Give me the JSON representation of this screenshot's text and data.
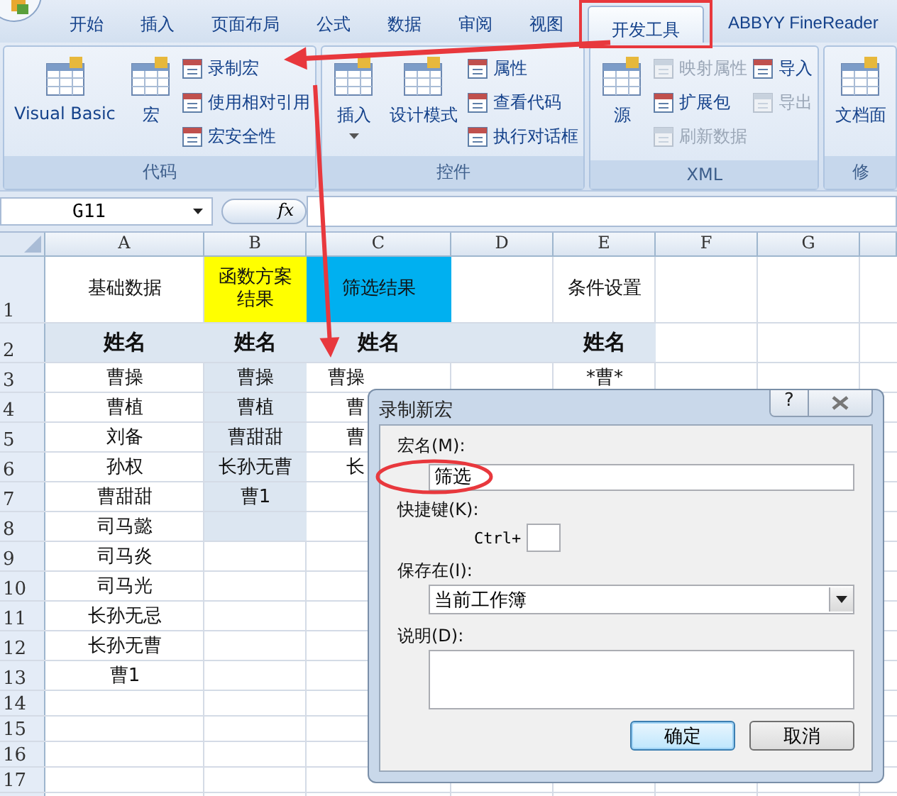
{
  "tabs": [
    {
      "label": "开始",
      "selected": false
    },
    {
      "label": "插入",
      "selected": false
    },
    {
      "label": "页面布局",
      "selected": false
    },
    {
      "label": "公式",
      "selected": false
    },
    {
      "label": "数据",
      "selected": false
    },
    {
      "label": "审阅",
      "selected": false
    },
    {
      "label": "视图",
      "selected": false
    },
    {
      "label": "开发工具",
      "selected": true
    },
    {
      "label": "ABBYY FineReader",
      "selected": false
    }
  ],
  "ribbon": {
    "groups": [
      {
        "label": "代码",
        "items": [
          {
            "label": "Visual Basic",
            "kind": "large",
            "disabled": false,
            "dropdown": false
          },
          {
            "label": "宏",
            "kind": "large",
            "disabled": false,
            "dropdown": false
          },
          {
            "label": "录制宏",
            "kind": "small",
            "disabled": false,
            "dropdown": false
          },
          {
            "label": "使用相对引用",
            "kind": "small",
            "disabled": false,
            "dropdown": false
          },
          {
            "label": "宏安全性",
            "kind": "small",
            "disabled": false,
            "dropdown": false
          }
        ]
      },
      {
        "label": "控件",
        "items": [
          {
            "label": "插入",
            "kind": "large",
            "disabled": false,
            "dropdown": true
          },
          {
            "label": "设计模式",
            "kind": "large",
            "disabled": false,
            "dropdown": false
          },
          {
            "label": "属性",
            "kind": "small",
            "disabled": false,
            "dropdown": false
          },
          {
            "label": "查看代码",
            "kind": "small",
            "disabled": false,
            "dropdown": false
          },
          {
            "label": "执行对话框",
            "kind": "small",
            "disabled": false,
            "dropdown": false
          }
        ]
      },
      {
        "label": "XML",
        "items": [
          {
            "label": "源",
            "kind": "large",
            "disabled": false,
            "dropdown": false
          },
          {
            "label": "映射属性",
            "kind": "small",
            "disabled": true,
            "dropdown": false
          },
          {
            "label": "扩展包",
            "kind": "small",
            "disabled": false,
            "dropdown": false
          },
          {
            "label": "刷新数据",
            "kind": "small",
            "disabled": true,
            "dropdown": false
          },
          {
            "label": "导入",
            "kind": "small",
            "disabled": false,
            "dropdown": false
          },
          {
            "label": "导出",
            "kind": "small",
            "disabled": true,
            "dropdown": false
          }
        ]
      },
      {
        "label": "修",
        "items": [
          {
            "label": "文档面",
            "kind": "large",
            "disabled": false,
            "dropdown": false
          }
        ]
      }
    ]
  },
  "formula_bar": {
    "name_box": "G11",
    "function_label": "fx"
  },
  "sheet": {
    "columns": [
      "A",
      "B",
      "C",
      "D",
      "E",
      "F",
      "G"
    ],
    "rows": [
      {
        "number": "1",
        "kind": "title",
        "cells": [
          {
            "text": "基础数据"
          },
          {
            "text": "函数方案结果",
            "color": "#ffff00"
          },
          {
            "text": "筛选结果",
            "color": "#00b0f0"
          },
          null,
          {
            "text": "条件设置"
          }
        ]
      },
      {
        "number": "2",
        "kind": "header",
        "cells": [
          {
            "text": "姓名",
            "color": "#dce6f1"
          },
          {
            "text": "姓名",
            "color": "#dce6f1"
          },
          {
            "text": "姓名",
            "color": "#dce6f1"
          },
          {
            "color": "#dce6f1"
          },
          {
            "text": "姓名",
            "color": "#dce6f1"
          }
        ]
      },
      {
        "number": "3",
        "kind": "data",
        "cells": [
          {
            "text": "曹操"
          },
          {
            "text": "曹操",
            "color": "#dce6f1"
          },
          {
            "text": "曹操"
          },
          null,
          {
            "text": "*曹*"
          }
        ]
      },
      {
        "number": "4",
        "kind": "data",
        "cells": [
          {
            "text": "曹植"
          },
          {
            "text": "曹植",
            "color": "#dce6f1"
          },
          {
            "text": "曹"
          }
        ]
      },
      {
        "number": "5",
        "kind": "data",
        "cells": [
          {
            "text": "刘备"
          },
          {
            "text": "曹甜甜",
            "color": "#dce6f1"
          },
          {
            "text": "曹"
          }
        ]
      },
      {
        "number": "6",
        "kind": "data",
        "cells": [
          {
            "text": "孙权"
          },
          {
            "text": "长孙无曹",
            "color": "#dce6f1"
          },
          {
            "text": "长"
          }
        ]
      },
      {
        "number": "7",
        "kind": "data",
        "cells": [
          {
            "text": "曹甜甜"
          },
          {
            "text": "曹1",
            "color": "#dce6f1"
          }
        ]
      },
      {
        "number": "8",
        "kind": "data",
        "cells": [
          {
            "text": "司马懿"
          },
          {
            "color": "#dce6f1"
          }
        ]
      },
      {
        "number": "9",
        "kind": "data",
        "cells": [
          {
            "text": "司马炎"
          }
        ]
      },
      {
        "number": "10",
        "kind": "data",
        "cells": [
          {
            "text": "司马光"
          }
        ]
      },
      {
        "number": "11",
        "kind": "data",
        "cells": [
          {
            "text": "长孙无忌"
          }
        ]
      },
      {
        "number": "12",
        "kind": "data",
        "cells": [
          {
            "text": "长孙无曹"
          }
        ]
      },
      {
        "number": "13",
        "kind": "data",
        "cells": [
          {
            "text": "曹1"
          }
        ]
      },
      {
        "number": "14",
        "kind": "empty",
        "cells": []
      },
      {
        "number": "15",
        "kind": "empty",
        "cells": []
      },
      {
        "number": "16",
        "kind": "empty",
        "cells": []
      },
      {
        "number": "17",
        "kind": "empty",
        "cells": []
      }
    ]
  },
  "dialog": {
    "title": "录制新宏",
    "help": "?",
    "macro_name": {
      "label": "宏名(M):",
      "value": "筛选"
    },
    "shortcut": {
      "label": "快捷键(K):",
      "prefix": "Ctrl+"
    },
    "store_in": {
      "label": "保存在(I):",
      "value": "当前工作簿"
    },
    "description": {
      "label": "说明(D):"
    },
    "buttons": [
      {
        "label": "确定",
        "default": true
      },
      {
        "label": "取消",
        "default": false
      }
    ]
  }
}
